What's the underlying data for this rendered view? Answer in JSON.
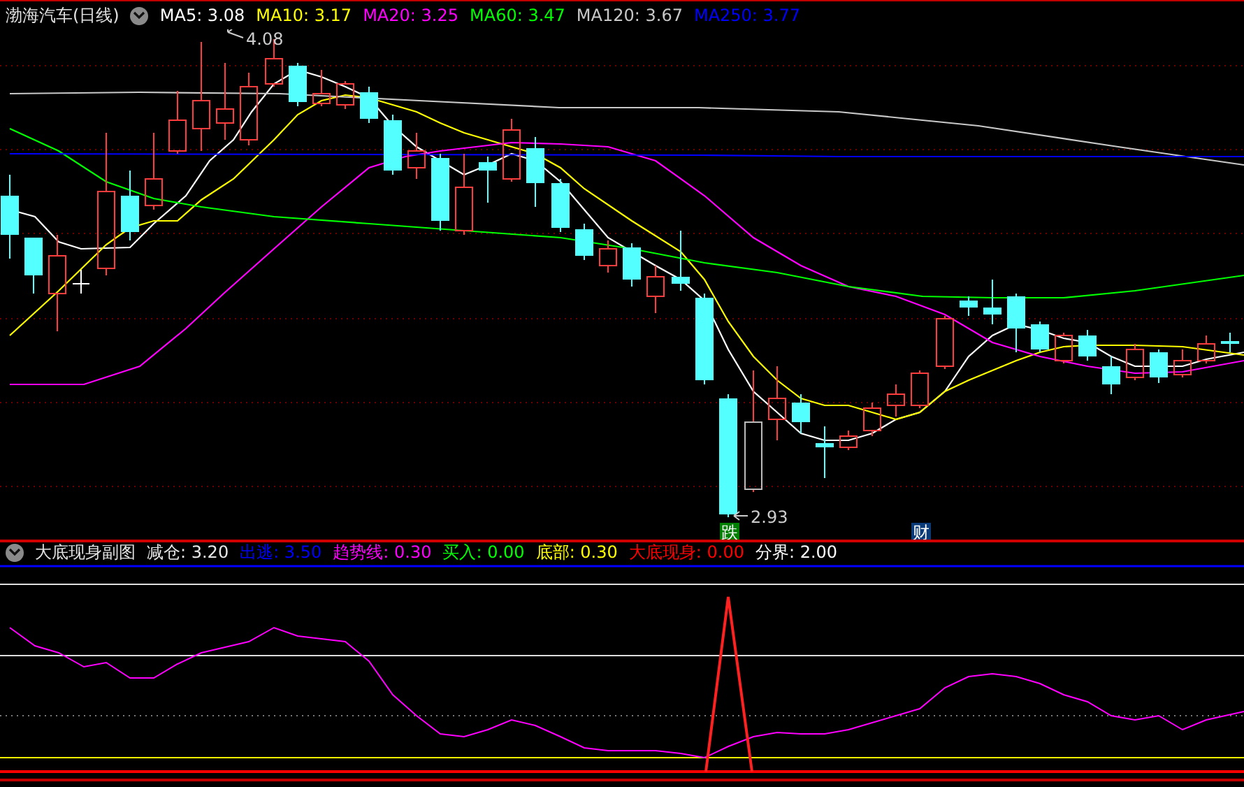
{
  "main_chart": {
    "title": "渤海汽车(日线)",
    "indicators": [
      {
        "label": "MA5:",
        "value": "3.08",
        "color": "#ffffff"
      },
      {
        "label": "MA10:",
        "value": "3.17",
        "color": "#ffff00"
      },
      {
        "label": "MA20:",
        "value": "3.25",
        "color": "#ff00ff"
      },
      {
        "label": "MA60:",
        "value": "3.47",
        "color": "#00ff00"
      },
      {
        "label": "MA120:",
        "value": "3.67",
        "color": "#c8c8c8"
      },
      {
        "label": "MA250:",
        "value": "3.77",
        "color": "#0000ff"
      }
    ],
    "high_label": "4.08",
    "low_label": "2.93",
    "markers": [
      {
        "text": "跌",
        "color": "#008000"
      },
      {
        "text": "财",
        "color": "#0a3a78"
      }
    ]
  },
  "sub_chart": {
    "title": "大底现身副图",
    "indicators": [
      {
        "label": "减仓:",
        "value": "3.20",
        "color": "#e8e8e8"
      },
      {
        "label": "出逃:",
        "value": "3.50",
        "color": "#0000ff"
      },
      {
        "label": "趋势线:",
        "value": "0.30",
        "color": "#ff00ff"
      },
      {
        "label": "买入:",
        "value": "0.00",
        "color": "#00ff00"
      },
      {
        "label": "底部:",
        "value": "0.30",
        "color": "#ffff00"
      },
      {
        "label": "大底现身:",
        "value": "0.00",
        "color": "#ff0000"
      },
      {
        "label": "分界:",
        "value": "2.00",
        "color": "#ffffff"
      }
    ]
  }
}
